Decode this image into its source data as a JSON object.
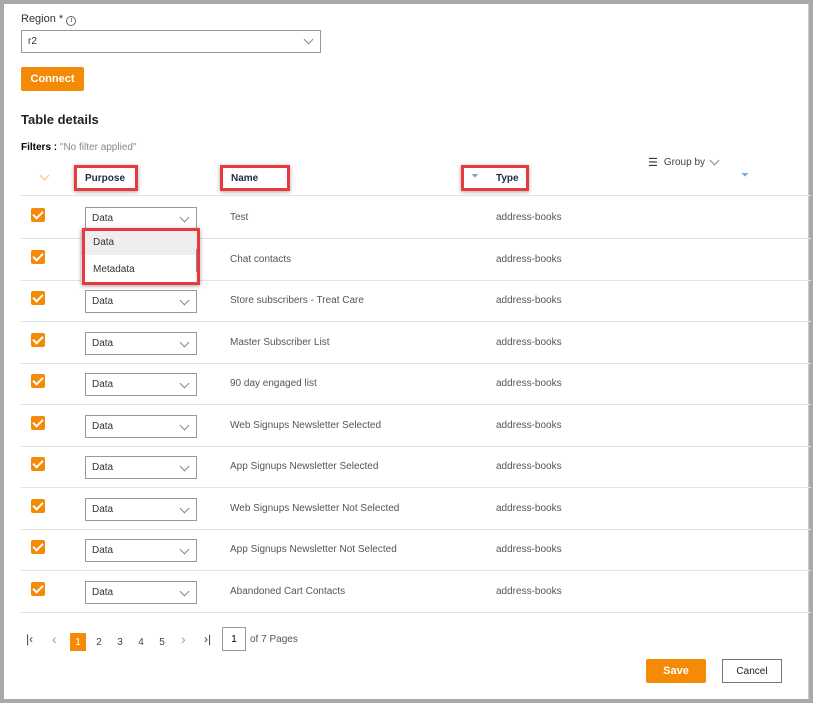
{
  "region": {
    "label": "Region *",
    "value": "r2"
  },
  "connect_label": "Connect",
  "section_title": "Table details",
  "filters": {
    "label": "Filters :",
    "value": "\"No filter applied\""
  },
  "group_by": "Group by",
  "columns": {
    "purpose": "Purpose",
    "name": "Name",
    "type": "Type"
  },
  "dropdown_options": [
    "Data",
    "Metadata"
  ],
  "rows": [
    {
      "purpose": "Data",
      "name": "Test",
      "type": "address-books",
      "checked": true
    },
    {
      "purpose": "Data",
      "name": "Chat contacts",
      "type": "address-books",
      "checked": true
    },
    {
      "purpose": "Data",
      "name": "Store subscribers - Treat Care",
      "type": "address-books",
      "checked": true
    },
    {
      "purpose": "Data",
      "name": "Master Subscriber List",
      "type": "address-books",
      "checked": true
    },
    {
      "purpose": "Data",
      "name": "90 day engaged list",
      "type": "address-books",
      "checked": true
    },
    {
      "purpose": "Data",
      "name": "Web Signups Newsletter Selected",
      "type": "address-books",
      "checked": true
    },
    {
      "purpose": "Data",
      "name": "App Signups Newsletter Selected",
      "type": "address-books",
      "checked": true
    },
    {
      "purpose": "Data",
      "name": "Web Signups Newsletter Not Selected",
      "type": "address-books",
      "checked": true
    },
    {
      "purpose": "Data",
      "name": "App Signups Newsletter Not Selected",
      "type": "address-books",
      "checked": true
    },
    {
      "purpose": "Data",
      "name": "Abandoned Cart Contacts",
      "type": "address-books",
      "checked": true
    }
  ],
  "pagination": {
    "pages": [
      "1",
      "2",
      "3",
      "4",
      "5"
    ],
    "current": "1",
    "input": "1",
    "of_label": "of 7 Pages"
  },
  "save_label": "Save",
  "cancel_label": "Cancel",
  "accent": "#f58a07"
}
